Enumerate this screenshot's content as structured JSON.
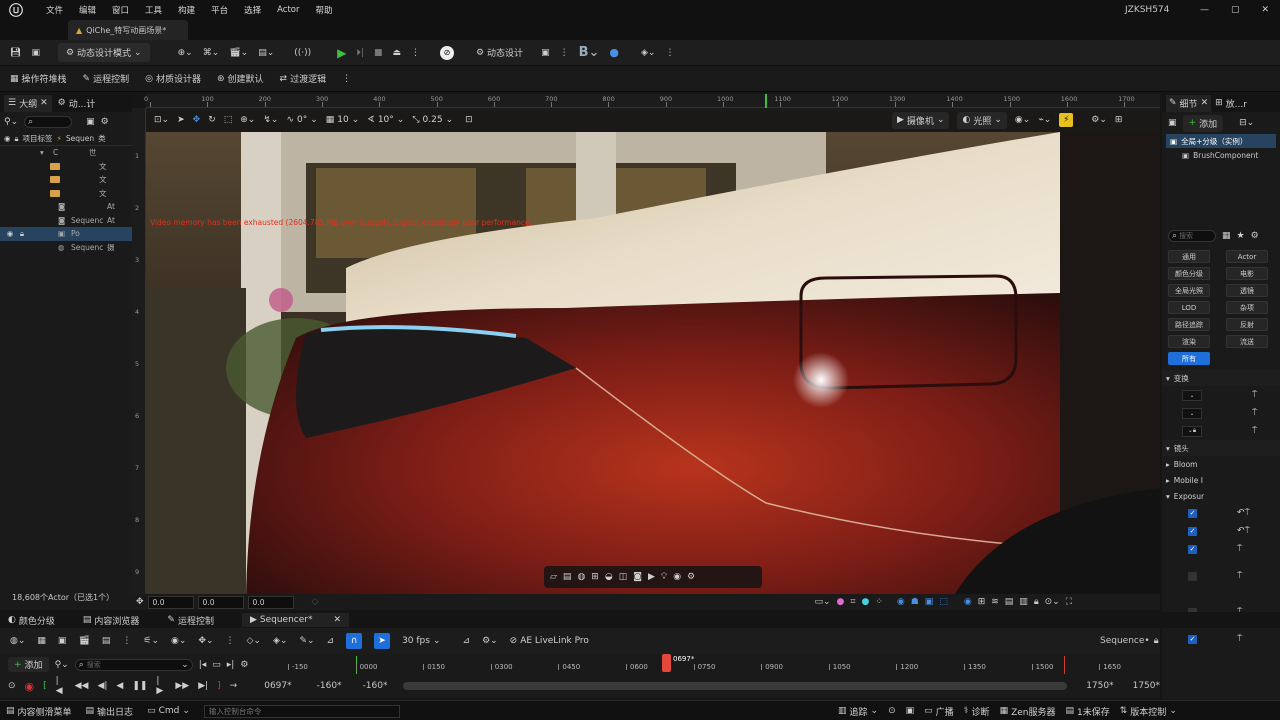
{
  "menubar": {
    "items": [
      "文件",
      "编辑",
      "窗口",
      "工具",
      "构建",
      "平台",
      "选择",
      "Actor",
      "帮助"
    ],
    "user": "JZKSH574"
  },
  "doc_tab": {
    "title": "QiChe_特写动画场景*"
  },
  "main_toolbar": {
    "mode_label": "动态设计模式",
    "motion_design_label": "动态设计",
    "b_label": "B"
  },
  "sub_toolbar": {
    "items": [
      "操作符堆栈",
      "运程控制",
      "材质设计器",
      "创建默认",
      "过渡逻辑"
    ]
  },
  "outliner": {
    "tab1": "大纲",
    "tab2": "动...计",
    "col_label": "项目标签",
    "col_seq": "Sequen",
    "col_type": "类",
    "rows": [
      {
        "label": "C",
        "type": "世"
      },
      {
        "label": "",
        "type": "文"
      },
      {
        "label": "",
        "type": "文"
      },
      {
        "label": "",
        "type": "文"
      },
      {
        "label": "",
        "type": "At"
      },
      {
        "label": "Sequenc",
        "type": "At"
      },
      {
        "label": "Po",
        "type": ""
      },
      {
        "label": "Sequenc",
        "type": "摄"
      }
    ],
    "footer": "18,608个Actor（已选1个）"
  },
  "viewport": {
    "camera_label": "摄像机",
    "lit_label": "光照",
    "snap_angle": "0°",
    "grid_size": "10",
    "rot_snap": "10°",
    "scale_snap": "0.25",
    "warning": "Video memory has been exhausted (2604.785 MB over budget). Expect extremely poor performance.",
    "coord_x": "0.0",
    "coord_y": "0.0",
    "coord_z": "0.0",
    "ruler_labels": [
      "0",
      "100",
      "200",
      "300",
      "400",
      "500",
      "600",
      "700",
      "800",
      "900",
      "1000",
      "1100",
      "1200",
      "1300",
      "1400",
      "1500",
      "1600",
      "1700"
    ],
    "ruler_left_labels": [
      "1",
      "2",
      "3",
      "4",
      "5",
      "6",
      "7",
      "8",
      "9"
    ]
  },
  "details": {
    "tab1": "细节",
    "tab2": "放...r",
    "add_label": "添加",
    "root_item": "全局+分级（实例）",
    "child_item": "BrushComponent",
    "search_placeholder": "搜索",
    "chips": [
      "通用",
      "Actor",
      "颜色分级",
      "电影",
      "全局光照",
      "透镜",
      "LOD",
      "杂项",
      "路径追踪",
      "反射",
      "渲染",
      "流送",
      "所有"
    ],
    "sections": {
      "transform": "变换",
      "lens": "镜头",
      "bloom": "Bloom",
      "mobile": "Mobile I",
      "exposure": "Exposur"
    }
  },
  "seq_tabs": {
    "items": [
      "颜色分级",
      "内容浏览器",
      "运程控制",
      "Sequencer*"
    ]
  },
  "seq_toolbar": {
    "fps": "30 fps",
    "livelink": "AE LiveLink Pro",
    "seq_name": "Sequence•"
  },
  "seq_track": {
    "add_label": "添加",
    "search_placeholder": "搜索",
    "current_frame": "0697*",
    "ticks": [
      "-150",
      "0000",
      "0150",
      "0300",
      "0450",
      "0600",
      "0750",
      "0900",
      "1050",
      "1200",
      "1350",
      "1500",
      "1650"
    ]
  },
  "seq_play": {
    "frame": "0697*",
    "start_a": "-160*",
    "start_b": "-160*",
    "end_a": "1750*",
    "end_b": "1750*"
  },
  "statusbar": {
    "content_drawer": "内容侧滑菜单",
    "output_log": "输出日志",
    "cmd": "Cmd",
    "cmd_placeholder": "输入控制台命令",
    "trace": "追踪",
    "broadcast": "广播",
    "diagnose": "诊断",
    "zen": "Zen服务器",
    "unsaved": "1未保存",
    "version": "版本控制"
  },
  "colors": {
    "accent": "#1e6fd9",
    "play_green": "#3fbf3f",
    "warning_red": "#d23a2a",
    "playhead": "#e5483a"
  }
}
